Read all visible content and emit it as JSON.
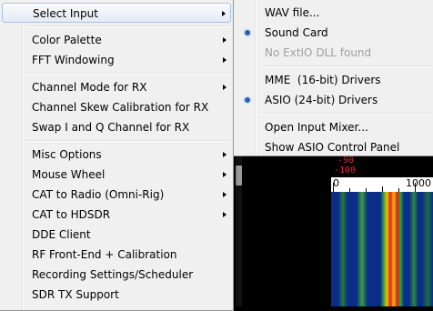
{
  "background": {
    "db_labels": [
      "-90",
      "-100"
    ],
    "scale_labels": [
      "0",
      "1000"
    ]
  },
  "main_menu": {
    "items": [
      {
        "label": "Select Input",
        "submenu": true,
        "highlighted": true
      },
      {
        "label": "Color Palette",
        "submenu": true
      },
      {
        "label": "FFT Windowing",
        "submenu": true
      },
      {
        "label": "Channel Mode for RX",
        "submenu": true
      },
      {
        "label": "Channel Skew Calibration for RX",
        "submenu": false
      },
      {
        "label": "Swap I and Q Channel for RX",
        "submenu": false
      },
      {
        "label": "Misc Options",
        "submenu": true
      },
      {
        "label": "Mouse Wheel",
        "submenu": true
      },
      {
        "label": "CAT to Radio (Omni-Rig)",
        "submenu": true
      },
      {
        "label": "CAT to HDSDR",
        "submenu": true
      },
      {
        "label": "DDE Client",
        "submenu": false
      },
      {
        "label": "RF Front-End + Calibration",
        "submenu": false
      },
      {
        "label": "Recording Settings/Scheduler",
        "submenu": false
      },
      {
        "label": "SDR TX Support",
        "submenu": false
      }
    ]
  },
  "submenu": {
    "items": [
      {
        "label": "WAV file...",
        "selected": false,
        "disabled": false
      },
      {
        "label": "Sound Card",
        "selected": true,
        "disabled": false
      },
      {
        "label": "No ExtIO DLL found",
        "selected": false,
        "disabled": true
      },
      {
        "label": "MME  (16-bit) Drivers",
        "selected": false,
        "disabled": false
      },
      {
        "label": "ASIO (24-bit) Drivers",
        "selected": true,
        "disabled": false
      },
      {
        "label": "Open Input Mixer...",
        "selected": false,
        "disabled": false
      },
      {
        "label": "Show ASIO Control Panel",
        "selected": false,
        "disabled": false
      }
    ]
  },
  "colors": {
    "highlight_border": "#a9c2e6",
    "radio": "#2b5fb3",
    "menu_bg": "#f0f0f0"
  }
}
